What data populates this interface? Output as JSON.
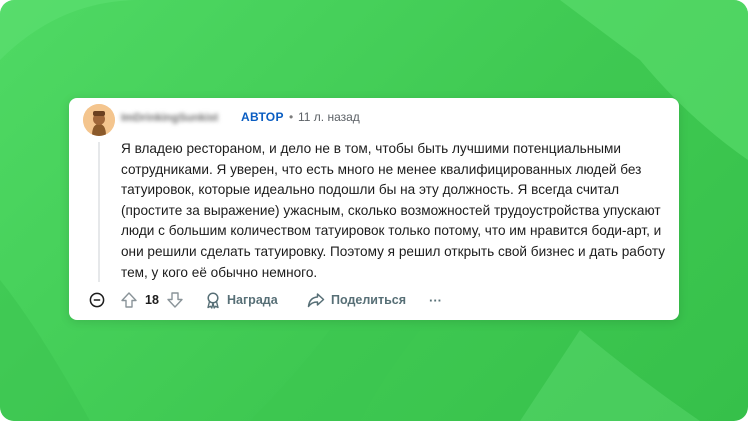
{
  "comment": {
    "username": "ImDrinkingSunkist",
    "badge": "АВТОР",
    "separator": "•",
    "time": "11 л. назад",
    "body": "Я владею рестораном, и дело не в том, чтобы быть лучшими потенциальными сотрудниками. Я уверен, что есть много не менее квалифицированных людей без татуировок, которые идеально подошли бы на эту должность. Я всегда считал (простите за выражение) ужасным, сколько возможностей трудоустройства упускают люди с большим количеством татуировок только потому, что им нравится боди-арт, и они решили сделать татуировку. Поэтому я решил открыть свой бизнес и дать работу тем, у кого её обычно немного."
  },
  "actions": {
    "vote_count": "18",
    "award_label": "Награда",
    "share_label": "Поделиться",
    "more_label": "···"
  },
  "colors": {
    "background": "#45d05a",
    "badge": "#0a5dc2",
    "action_text": "#576f76"
  },
  "icons": [
    "collapse-icon",
    "upvote-icon",
    "downvote-icon",
    "award-icon",
    "share-icon",
    "more-icon"
  ]
}
